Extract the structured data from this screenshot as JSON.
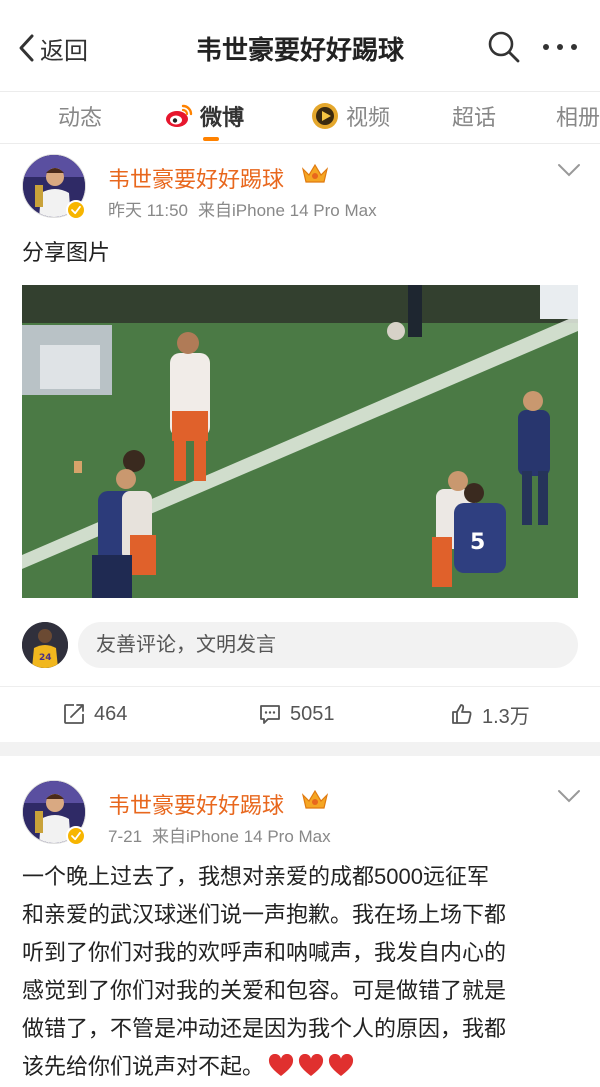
{
  "header": {
    "back_label": "返回",
    "title": "韦世豪要好好踢球"
  },
  "tabs": [
    {
      "label": "动态",
      "active": false
    },
    {
      "label": "微博",
      "active": true
    },
    {
      "label": "视频",
      "active": false
    },
    {
      "label": "超话",
      "active": false
    },
    {
      "label": "相册",
      "active": false
    }
  ],
  "colors": {
    "accent": "#ff8200",
    "name": "#e8671d",
    "badge": "#f7b500"
  },
  "posts": [
    {
      "author": "韦世豪要好好踢球",
      "time": "昨天 11:50",
      "source": "来自iPhone 14 Pro Max",
      "text": "分享图片",
      "comment_placeholder": "友善评论，文明发言",
      "reposts": "464",
      "comments": "5051",
      "likes": "1.3万"
    },
    {
      "author": "韦世豪要好好踢球",
      "time": "7-21",
      "source": "来自iPhone 14 Pro Max",
      "text_lines": [
        "一个晚上过去了，我想对亲爱的成都5000远征军",
        "和亲爱的武汉球迷们说一声抱歉。我在场上场下都",
        "听到了你们对我的欢呼声和呐喊声，我发自内心的",
        "感觉到了你们对我的关爱和包容。可是做错了就是",
        "做错了，不管是冲动还是因为我个人的原因，我都",
        "该先给你们说声对不起。"
      ]
    }
  ],
  "icons": {
    "back": "chevron-left-icon",
    "search": "search-icon",
    "more": "more-dots-icon",
    "weibo_tab": "weibo-logo-icon",
    "video_tab": "video-play-icon",
    "repost": "repost-icon",
    "comment": "comment-icon",
    "like": "thumbs-up-icon",
    "heart": "red-heart-icon"
  }
}
